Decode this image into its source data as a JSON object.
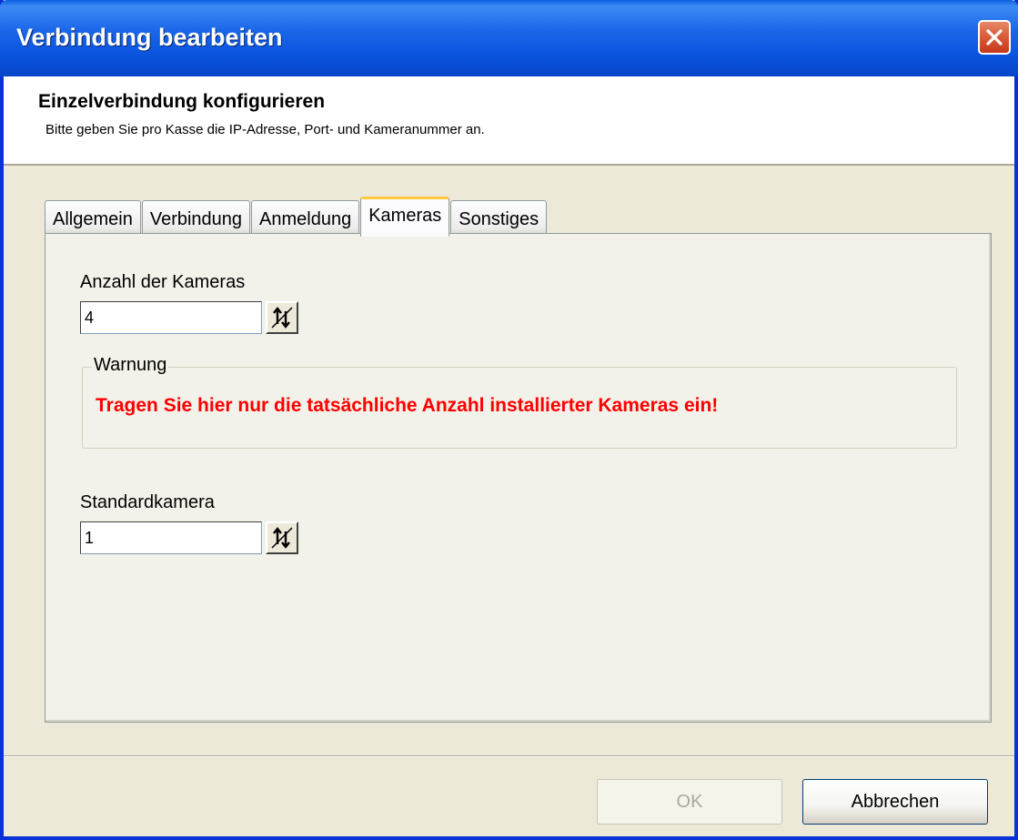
{
  "window": {
    "title": "Verbindung bearbeiten"
  },
  "header": {
    "title": "Einzelverbindung konfigurieren",
    "subtitle": "Bitte geben Sie pro Kasse die IP-Adresse, Port- und Kameranummer an."
  },
  "tabs": [
    {
      "label": "Allgemein",
      "active": false
    },
    {
      "label": "Verbindung",
      "active": false
    },
    {
      "label": "Anmeldung",
      "active": false
    },
    {
      "label": "Kameras",
      "active": true
    },
    {
      "label": "Sonstiges",
      "active": false
    }
  ],
  "kameras": {
    "anzahl_label": "Anzahl der Kameras",
    "anzahl_value": "4",
    "warning_legend": "Warnung",
    "warning_text": "Tragen Sie hier nur die tatsächliche Anzahl installierter Kameras ein!",
    "standard_label": "Standardkamera",
    "standard_value": "1"
  },
  "buttons": {
    "ok": "OK",
    "cancel": "Abbrechen"
  },
  "colors": {
    "title_bar": "#0b55e0",
    "warning": "#ff0000",
    "active_tab_accent": "#ffc83c"
  },
  "icons": {
    "close": "close-icon",
    "spin": "spin-arrows-icon"
  }
}
